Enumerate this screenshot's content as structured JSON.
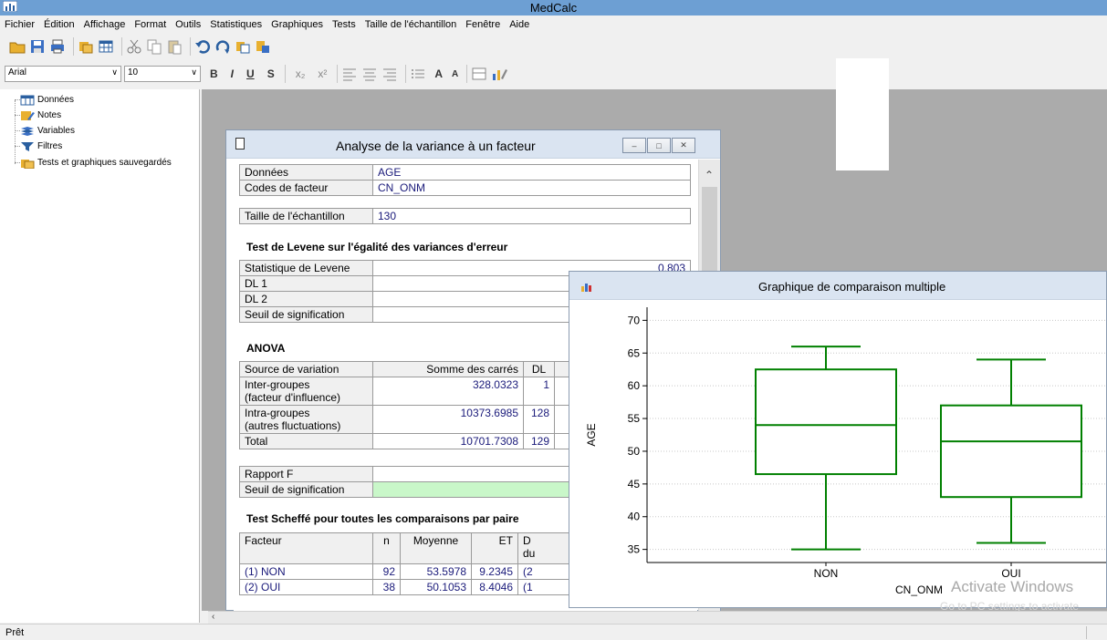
{
  "window": {
    "title": "MedCalc"
  },
  "menu": [
    "Fichier",
    "Édition",
    "Affichage",
    "Format",
    "Outils",
    "Statistiques",
    "Graphiques",
    "Tests",
    "Taille de l'échantillon",
    "Fenêtre",
    "Aide"
  ],
  "format_toolbar": {
    "font": "Arial",
    "size": "10",
    "bold": "B",
    "italic": "I",
    "underline": "U",
    "strike": "S",
    "subscript": "x₂",
    "superscript": "x²",
    "grow": "A",
    "shrink": "A"
  },
  "tree": {
    "items": [
      {
        "label": "Données",
        "icon": "table-icon"
      },
      {
        "label": "Notes",
        "icon": "notes-icon"
      },
      {
        "label": "Variables",
        "icon": "variables-icon"
      },
      {
        "label": "Filtres",
        "icon": "filter-icon"
      },
      {
        "label": "Tests et graphiques sauvegardés",
        "icon": "saved-tests-icon"
      }
    ]
  },
  "anova_window": {
    "title": "Analyse de la variance à un facteur",
    "rows_data": [
      {
        "label": "Données",
        "value": "AGE"
      },
      {
        "label": "Codes de facteur",
        "value": "CN_ONM"
      }
    ],
    "sample_size": {
      "label": "Taille de l'échantillon",
      "value": "130"
    },
    "levene": {
      "heading": "Test de Levene sur l'égalité des variances d'erreur",
      "rows": [
        {
          "label": "Statistique de Levene",
          "value": "0.803"
        },
        {
          "label": "DL 1",
          "value": ""
        },
        {
          "label": "DL 2",
          "value": ""
        },
        {
          "label": "Seuil de signification",
          "value": ""
        }
      ]
    },
    "anova": {
      "heading": "ANOVA",
      "headers": [
        "Source de variation",
        "Somme des carrés",
        "DL"
      ],
      "rows": [
        {
          "source": "Inter-groupes",
          "source2": "(facteur d'influence)",
          "ss": "328.0323",
          "df": "1"
        },
        {
          "source": "Intra-groupes",
          "source2": "(autres fluctuations)",
          "ss": "10373.6985",
          "df": "128"
        },
        {
          "source": "Total",
          "source2": "",
          "ss": "10701.7308",
          "df": "129"
        }
      ],
      "f_rows": [
        {
          "label": "Rapport F"
        },
        {
          "label": "Seuil de signification"
        }
      ]
    },
    "scheffe": {
      "heading": "Test Scheffé pour toutes les comparaisons par paire",
      "headers": [
        "Facteur",
        "n",
        "Moyenne",
        "ET",
        "D",
        "du"
      ],
      "rows": [
        {
          "factor": "(1) NON",
          "n": "92",
          "mean": "53.5978",
          "sd": "9.2345",
          "diff": "(2"
        },
        {
          "factor": "(2) OUI",
          "n": "38",
          "mean": "50.1053",
          "sd": "8.4046",
          "diff": "(1"
        }
      ]
    }
  },
  "chart_window": {
    "title": "Graphique de comparaison multiple"
  },
  "chart_data": {
    "type": "box",
    "xlabel": "CN_ONM",
    "ylabel": "AGE",
    "ylim": [
      33,
      72
    ],
    "yticks": [
      35,
      40,
      45,
      50,
      55,
      60,
      65,
      70
    ],
    "grid": true,
    "color": "#008000",
    "categories": [
      "NON",
      "OUI"
    ],
    "boxes": [
      {
        "name": "NON",
        "min": 35,
        "q1": 46.5,
        "median": 54,
        "q3": 62.5,
        "max": 66
      },
      {
        "name": "OUI",
        "min": 36,
        "q1": 43,
        "median": 51.5,
        "q3": 57,
        "max": 64
      }
    ]
  },
  "watermark": {
    "line1": "Activate Windows",
    "line2": "Go to PC settings to activate"
  },
  "status": {
    "text": "Prêt"
  }
}
